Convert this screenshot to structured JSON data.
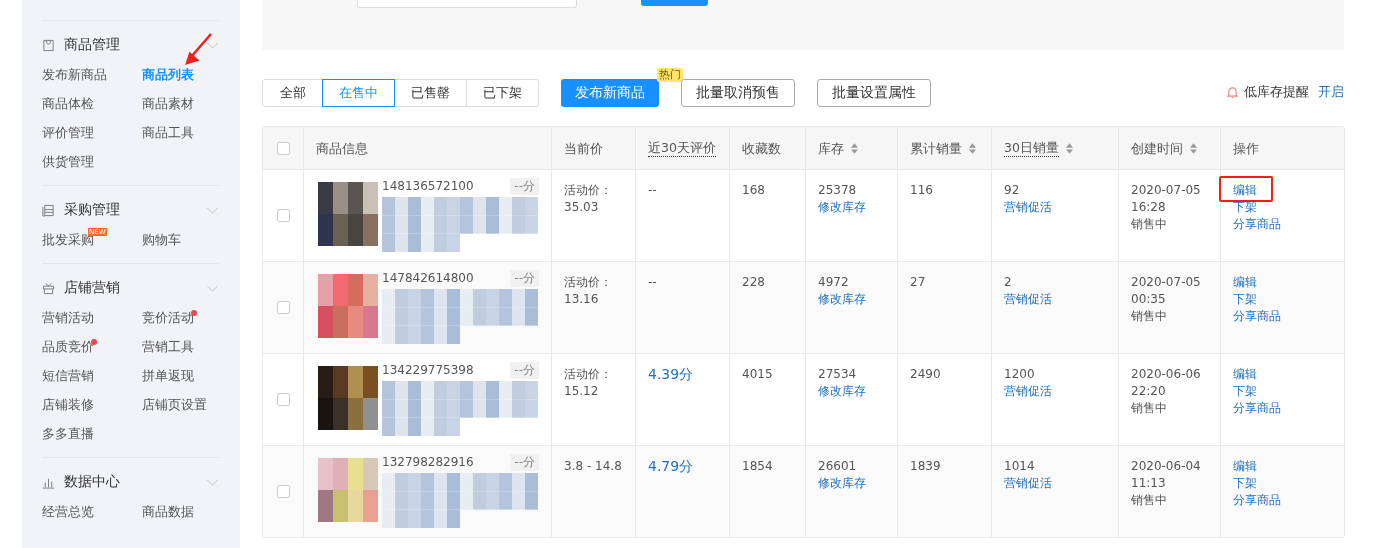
{
  "sidebar": {
    "groups": [
      {
        "title": "商品管理",
        "items": [
          {
            "label": "发布新商品",
            "selected": false,
            "dot": false
          },
          {
            "label": "商品列表",
            "selected": true,
            "dot": false
          },
          {
            "label": "商品体检",
            "selected": false,
            "dot": false
          },
          {
            "label": "商品素材",
            "selected": false,
            "dot": false
          },
          {
            "label": "评价管理",
            "selected": false,
            "dot": false
          },
          {
            "label": "商品工具",
            "selected": false,
            "dot": false
          },
          {
            "label": "供货管理",
            "selected": false,
            "dot": false
          }
        ]
      },
      {
        "title": "采购管理",
        "items": [
          {
            "label": "批发采购",
            "selected": false,
            "dot": false,
            "badge": "NEW"
          },
          {
            "label": "购物车",
            "selected": false,
            "dot": false
          }
        ]
      },
      {
        "title": "店铺营销",
        "items": [
          {
            "label": "营销活动",
            "selected": false,
            "dot": false
          },
          {
            "label": "竞价活动",
            "selected": false,
            "dot": true
          },
          {
            "label": "品质竞价",
            "selected": false,
            "dot": true
          },
          {
            "label": "营销工具",
            "selected": false,
            "dot": false
          },
          {
            "label": "短信营销",
            "selected": false,
            "dot": false
          },
          {
            "label": "拼单返现",
            "selected": false,
            "dot": false
          },
          {
            "label": "店铺装修",
            "selected": false,
            "dot": false
          },
          {
            "label": "店铺页设置",
            "selected": false,
            "dot": false
          },
          {
            "label": "多多直播",
            "selected": false,
            "dot": false
          }
        ]
      },
      {
        "title": "数据中心",
        "items": [
          {
            "label": "经营总览",
            "selected": false,
            "dot": false
          },
          {
            "label": "商品数据",
            "selected": false,
            "dot": false
          }
        ]
      }
    ]
  },
  "tabs": [
    {
      "label": "全部",
      "selected": false
    },
    {
      "label": "在售中",
      "selected": true
    },
    {
      "label": "已售罄",
      "selected": false
    },
    {
      "label": "已下架",
      "selected": false
    }
  ],
  "actions": [
    {
      "label": "发布新商品",
      "kind": "primary",
      "badge": "热门"
    },
    {
      "label": "批量取消预售",
      "kind": "default"
    },
    {
      "label": "批量设置属性",
      "kind": "default"
    }
  ],
  "low_stock": {
    "label": "低库存提醒",
    "link": "开启"
  },
  "table": {
    "select_all": {
      "checked": false
    },
    "columns": [
      {
        "label": "商品信息",
        "sortable": false,
        "dotted": false
      },
      {
        "label": "当前价",
        "sortable": false,
        "dotted": false
      },
      {
        "label": "近30天评价",
        "sortable": false,
        "dotted": true
      },
      {
        "label": "收藏数",
        "sortable": false,
        "dotted": false
      },
      {
        "label": "库存",
        "sortable": true,
        "dotted": false
      },
      {
        "label": "累计销量",
        "sortable": true,
        "dotted": false
      },
      {
        "label": "30日销量",
        "sortable": true,
        "dotted": true
      },
      {
        "label": "创建时间",
        "sortable": true,
        "dotted": false
      },
      {
        "label": "操作",
        "sortable": false,
        "dotted": false
      }
    ],
    "rows": [
      {
        "checked": false,
        "id": "148136572100",
        "score": "--分",
        "price": [
          "活动价：",
          "35.03"
        ],
        "rating": "--",
        "emphasized": false,
        "favorites": "168",
        "stock": "25378",
        "stock_link": "修改库存",
        "total_sales": "116",
        "sales_30d": "92",
        "sales_link": "营销促活",
        "created": [
          "2020-07-05",
          "16:28"
        ],
        "status": "销售中",
        "ops": [
          "编辑",
          "下架",
          "分享商品"
        ],
        "highlight_edit": true
      },
      {
        "checked": false,
        "id": "147842614800",
        "score": "--分",
        "price": [
          "活动价：",
          "13.16"
        ],
        "rating": "--",
        "emphasized": false,
        "favorites": "228",
        "stock": "4972",
        "stock_link": "修改库存",
        "total_sales": "27",
        "sales_30d": "2",
        "sales_link": "营销促活",
        "created": [
          "2020-07-05",
          "00:35"
        ],
        "status": "销售中",
        "ops": [
          "编辑",
          "下架",
          "分享商品"
        ],
        "highlight_edit": false
      },
      {
        "checked": false,
        "id": "134229775398",
        "score": "--分",
        "price": [
          "活动价：",
          "15.12"
        ],
        "rating": "4.39分",
        "emphasized": true,
        "favorites": "4015",
        "stock": "27534",
        "stock_link": "修改库存",
        "total_sales": "2490",
        "sales_30d": "1200",
        "sales_link": "营销促活",
        "created": [
          "2020-06-06",
          "22:20"
        ],
        "status": "销售中",
        "ops": [
          "编辑",
          "下架",
          "分享商品"
        ],
        "highlight_edit": false
      },
      {
        "checked": false,
        "id": "132798282916",
        "score": "--分",
        "price": [
          "3.8 - 14.8"
        ],
        "rating": "4.79分",
        "emphasized": true,
        "favorites": "1854",
        "stock": "26601",
        "stock_link": "修改库存",
        "total_sales": "1839",
        "sales_30d": "1014",
        "sales_link": "营销促活",
        "created": [
          "2020-06-04",
          "11:13"
        ],
        "status": "销售中",
        "ops": [
          "编辑",
          "下架",
          "分享商品"
        ],
        "highlight_edit": false
      }
    ]
  }
}
